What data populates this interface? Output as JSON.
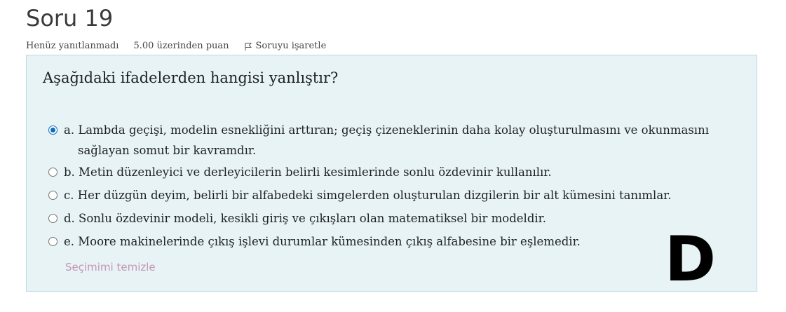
{
  "question": {
    "title": "Soru 19",
    "status": "Henüz yanıtlanmadı",
    "points": "5.00 üzerinden puan",
    "flag_label": "Soruyu işaretle",
    "text": "Aşağıdaki ifadelerden hangisi yanlıştır?",
    "clear_label": "Seçimimi temizle"
  },
  "answers": [
    {
      "line1": "a. Lambda geçişi, modelin esnekliğini arttıran; geçiş çizeneklerinin daha kolay oluşturulmasını ve okunmasını",
      "line2": "sağlayan somut bir kavramdır.",
      "selected": true
    },
    {
      "line1": "b. Metin düzenleyici ve derleyicilerin belirli kesimlerinde sonlu özdevinir kullanılır.",
      "selected": false
    },
    {
      "line1": "c. Her düzgün deyim, belirli bir alfabedeki simgelerden oluşturulan dizgilerin bir alt kümesini tanımlar.",
      "selected": false
    },
    {
      "line1": "d. Sonlu özdevinir modeli, kesikli giriş ve çıkışları olan matematiksel bir modeldir.",
      "selected": false
    },
    {
      "line1": "e. Moore makinelerinde çıkış işlevi durumlar kümesinden çıkış alfabesine bir eşlemedir.",
      "selected": false
    }
  ],
  "overlay": {
    "letter": "D"
  },
  "colors": {
    "panel_bg": "#e7f3f5",
    "panel_border": "#b8dce2",
    "radio_checked": "#0f6cbf",
    "clear_link": "#c596b4"
  }
}
